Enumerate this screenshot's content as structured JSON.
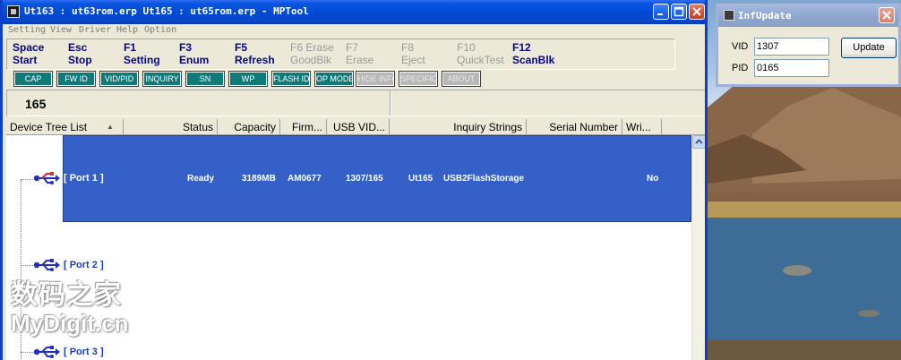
{
  "window": {
    "title": "Ut163 : ut63rom.erp Ut165 : ut65rom.erp  - MPTool"
  },
  "menu": [
    "Setting",
    "View",
    "Driver",
    "Help",
    "Option"
  ],
  "toolbar": [
    {
      "key": "Space",
      "label": "Start",
      "enabled": true
    },
    {
      "key": "Esc",
      "label": "Stop",
      "enabled": true
    },
    {
      "key": "F1",
      "label": "Setting",
      "enabled": true
    },
    {
      "key": "F3",
      "label": "Enum",
      "enabled": true
    },
    {
      "key": "F5",
      "label": "Refresh",
      "enabled": true
    },
    {
      "key": "F6 Erase",
      "label": "GoodBlk",
      "enabled": false
    },
    {
      "key": "F7",
      "label": "Erase",
      "enabled": false
    },
    {
      "key": "F8",
      "label": "Eject",
      "enabled": false
    },
    {
      "key": "F10",
      "label": "QuickTest",
      "enabled": false
    },
    {
      "key": "F12",
      "label": "ScanBlk",
      "enabled": true
    }
  ],
  "buttons": [
    {
      "label": "CAP",
      "enabled": true
    },
    {
      "label": "FW ID",
      "enabled": true
    },
    {
      "label": "VID/PID",
      "enabled": true
    },
    {
      "label": "INQUIRY",
      "enabled": true
    },
    {
      "label": "SN",
      "enabled": true
    },
    {
      "label": "WP",
      "enabled": true
    },
    {
      "label": "FLASH ID",
      "enabled": true
    },
    {
      "label": "OP MODE",
      "enabled": true
    },
    {
      "label": "HIDE INFO",
      "enabled": false
    },
    {
      "label": "SPECIFIC",
      "enabled": false
    },
    {
      "label": "ABOUT",
      "enabled": false
    }
  ],
  "info": {
    "count": "165"
  },
  "columns": [
    "Device Tree List",
    "Status",
    "Capacity",
    "Firm...",
    "USB VID...",
    "Inquiry Strings",
    "Serial Number",
    "Wri..."
  ],
  "sort_indicator": "▲",
  "rows": [
    {
      "port": "[ Port  1 ]",
      "selected": true,
      "status": "Ready",
      "capacity": "3189MB",
      "firmware": "AM0677",
      "vidpid": "1307/165",
      "chip": "Ut165",
      "inquiry": "USB2FlashStorage",
      "write_protect": "No"
    },
    {
      "port": "[ Port  2 ]",
      "selected": false
    },
    {
      "port": "[ Port  3 ]",
      "selected": false
    }
  ],
  "dialog": {
    "title": "InfUpdate",
    "vid_label": "VID",
    "vid_value": "1307",
    "pid_label": "PID",
    "pid_value": "0165",
    "update_label": "Update"
  },
  "watermark": {
    "chinese": "数码之家",
    "latin": "MyDigit.cn"
  },
  "colors": {
    "titlebar": "#0049d4",
    "selection": "#3560c8",
    "button_on": "#0f7a7a",
    "button_off": "#b8b8b8",
    "port_label": "#1a3cc8"
  }
}
